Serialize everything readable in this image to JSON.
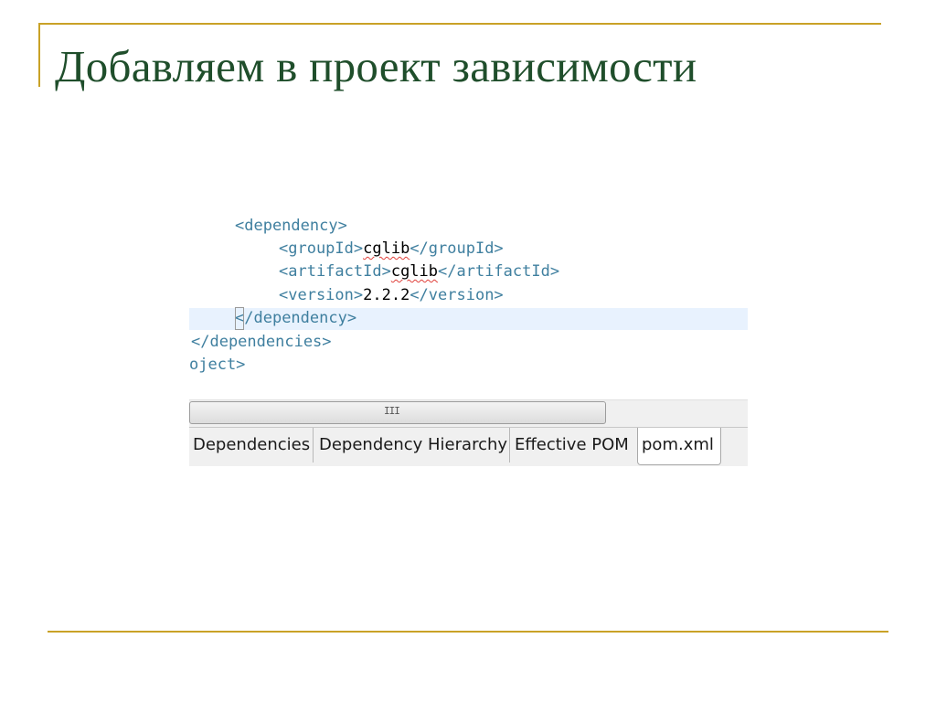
{
  "slide": {
    "title": "Добавляем в проект зависимости"
  },
  "editor": {
    "lines": {
      "dependency_open": "<dependency>",
      "group_open": "<groupId>",
      "group_value": "cglib",
      "group_close": "</groupId>",
      "artifact_open": "<artifactId>",
      "artifact_value": "cglib",
      "artifact_close": "</artifactId>",
      "version_open": "<version>",
      "version_value": "2.2.2",
      "version_close": "</version>",
      "dependency_close_lt": "<",
      "dependency_close_rest": "/dependency>",
      "dependencies_close": "</dependencies>",
      "project_close": "oject>"
    },
    "scrollbar_grip": "III"
  },
  "tabs": [
    {
      "label": "Dependencies"
    },
    {
      "label": "Dependency Hierarchy"
    },
    {
      "label": "Effective POM"
    },
    {
      "label": "pom.xml",
      "active": true
    }
  ],
  "colors": {
    "title": "#1f4e2b",
    "frame": "#c9a227",
    "xml_tag": "#3f7f9f"
  }
}
